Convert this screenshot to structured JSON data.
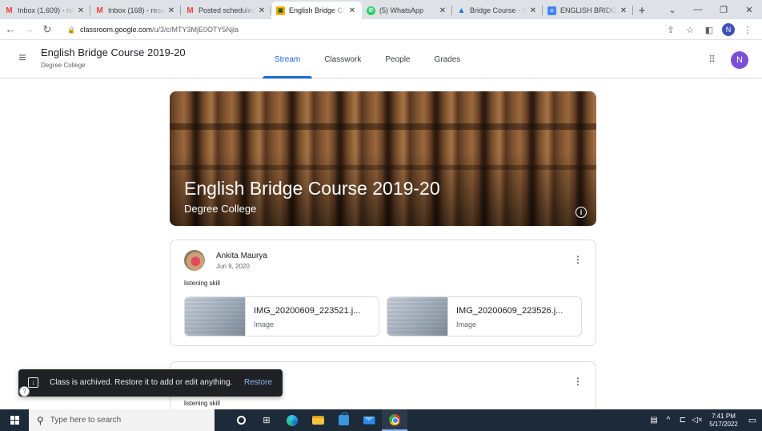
{
  "browser": {
    "tabs": [
      {
        "icon": "gmail-icon",
        "title": "Inbox (1,609) - na",
        "active": false,
        "fade": true
      },
      {
        "icon": "gmail-icon",
        "title": "Inbox (168) - rese",
        "active": false,
        "fade": true
      },
      {
        "icon": "gmail-icon",
        "title": "Posted scheduled",
        "active": false,
        "fade": true
      },
      {
        "icon": "classroom-icon",
        "title": "English Bridge Co",
        "active": true,
        "fade": true
      },
      {
        "icon": "whatsapp-icon",
        "title": "(5) WhatsApp",
        "active": false,
        "fade": false
      },
      {
        "icon": "drive-icon",
        "title": "Bridge Course - G",
        "active": false,
        "fade": true
      },
      {
        "icon": "forms-icon",
        "title": "ENGLISH BRIDGE",
        "active": false,
        "fade": true
      }
    ],
    "url_host": "classroom.google.com",
    "url_path": "/u/3/c/MTY3MjE0OTY5Njla",
    "profile_initial": "N"
  },
  "classroom": {
    "course_title": "English Bridge Course 2019-20",
    "course_section": "Degree College",
    "tabs": [
      {
        "label": "Stream",
        "active": true
      },
      {
        "label": "Classwork",
        "active": false
      },
      {
        "label": "People",
        "active": false
      },
      {
        "label": "Grades",
        "active": false
      }
    ],
    "user_initial": "N"
  },
  "banner": {
    "title": "English Bridge Course 2019-20",
    "subtitle": "Degree College"
  },
  "posts": [
    {
      "author": "Ankita Maurya",
      "date": "Jun 9, 2020",
      "text": "listening skill",
      "attachments": [
        {
          "name": "IMG_20200609_223521.j...",
          "type": "Image"
        },
        {
          "name": "IMG_20200609_223526.j...",
          "type": "Image"
        }
      ]
    },
    {
      "text": "listening skill"
    }
  ],
  "snackbar": {
    "message": "Class is archived. Restore it to add or edit anything.",
    "action": "Restore"
  },
  "taskbar": {
    "search_placeholder": "Type here to search",
    "time": "7:41 PM",
    "date": "5/17/2022"
  },
  "colors": {
    "accent": "#1967d2",
    "avatar": "#7b4fd6",
    "snackbar_bg": "#202124",
    "snackbar_action": "#8ab4f8"
  }
}
